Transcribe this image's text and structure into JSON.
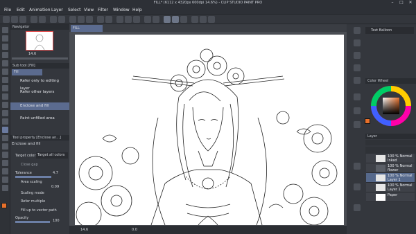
{
  "window": {
    "title": "FILL* (6112 x 4320px 600dpi 14.6%) - CLIP STUDIO PAINT PRO",
    "minimize": "–",
    "maximize": "□",
    "close": "✕"
  },
  "menu": [
    "File",
    "Edit",
    "Animation",
    "Layer",
    "Select",
    "View",
    "Filter",
    "Window",
    "Help"
  ],
  "canvas_tab": "FILL",
  "navigator": {
    "title": "Navigator",
    "zoom": "14.6"
  },
  "subtool": {
    "header": "Sub tool [Fill]",
    "group_label": "Fill",
    "items": [
      {
        "label": "Refer only to editing layer"
      },
      {
        "label": "Refer other layers"
      },
      {
        "label": "Enclose and fill"
      },
      {
        "label": "Paint unfilled area"
      }
    ]
  },
  "tool_property": {
    "header": "Tool property [Enclose an...]",
    "tool_name": "Enclose and fill",
    "target_color_label": "Target color",
    "target_color_value": "Target all colors",
    "close_gap_label": "Close gap",
    "tolerance_label": "Tolerance",
    "tolerance_value": "4.7",
    "area_scaling_label": "Area scaling",
    "area_scaling_value": "0.09",
    "scaling_mode_label": "Scaling mode",
    "refer_multiple_label": "Refer multiple",
    "fill_vector_label": "Fill up to vector path",
    "opacity_label": "Opacity",
    "opacity_value": "100"
  },
  "status": {
    "zoom": "14.6",
    "coord": "0.0"
  },
  "right": {
    "text_balloon": "Text Balloon",
    "color_wheel_header": "Color Wheel",
    "layer_header": "Layer"
  },
  "layers": [
    {
      "line1": "100 % Normal",
      "line2": "Inked"
    },
    {
      "line1": "100 % Normal",
      "line2": "flower"
    },
    {
      "line1": "100 % Normal",
      "line2": "Layer 1"
    },
    {
      "line1": "100 % Normal",
      "line2": "Layer 1"
    },
    {
      "line1": "Paper",
      "line2": ""
    }
  ],
  "colors": {
    "selected_layer": "#56698c",
    "main_color": "#e8702a",
    "sub_color": "#ffffff",
    "selection": "#5b6b8f"
  }
}
